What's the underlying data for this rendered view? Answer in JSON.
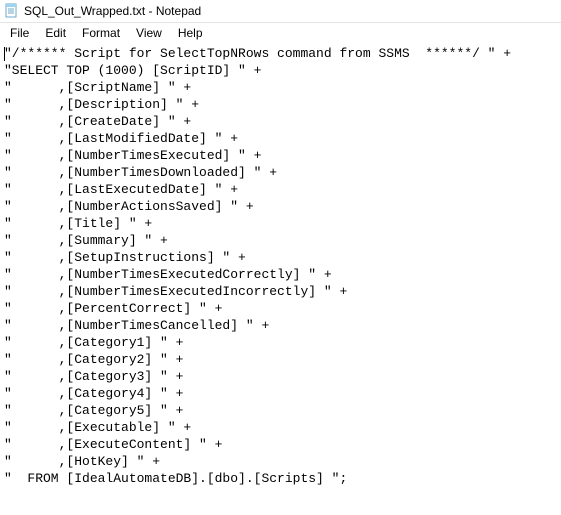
{
  "window": {
    "title": "SQL_Out_Wrapped.txt - Notepad"
  },
  "menu": {
    "file": "File",
    "edit": "Edit",
    "format": "Format",
    "view": "View",
    "help": "Help"
  },
  "editor": {
    "lines": [
      "\"/****** Script for SelectTopNRows command from SSMS  ******/ \" +",
      "\"SELECT TOP (1000) [ScriptID] \" +",
      "\"      ,[ScriptName] \" +",
      "\"      ,[Description] \" +",
      "\"      ,[CreateDate] \" +",
      "\"      ,[LastModifiedDate] \" +",
      "\"      ,[NumberTimesExecuted] \" +",
      "\"      ,[NumberTimesDownloaded] \" +",
      "\"      ,[LastExecutedDate] \" +",
      "\"      ,[NumberActionsSaved] \" +",
      "\"      ,[Title] \" +",
      "\"      ,[Summary] \" +",
      "\"      ,[SetupInstructions] \" +",
      "\"      ,[NumberTimesExecutedCorrectly] \" +",
      "\"      ,[NumberTimesExecutedIncorrectly] \" +",
      "\"      ,[PercentCorrect] \" +",
      "\"      ,[NumberTimesCancelled] \" +",
      "\"      ,[Category1] \" +",
      "\"      ,[Category2] \" +",
      "\"      ,[Category3] \" +",
      "\"      ,[Category4] \" +",
      "\"      ,[Category5] \" +",
      "\"      ,[Executable] \" +",
      "\"      ,[ExecuteContent] \" +",
      "\"      ,[HotKey] \" +",
      "\"  FROM [IdealAutomateDB].[dbo].[Scripts] \";"
    ]
  }
}
